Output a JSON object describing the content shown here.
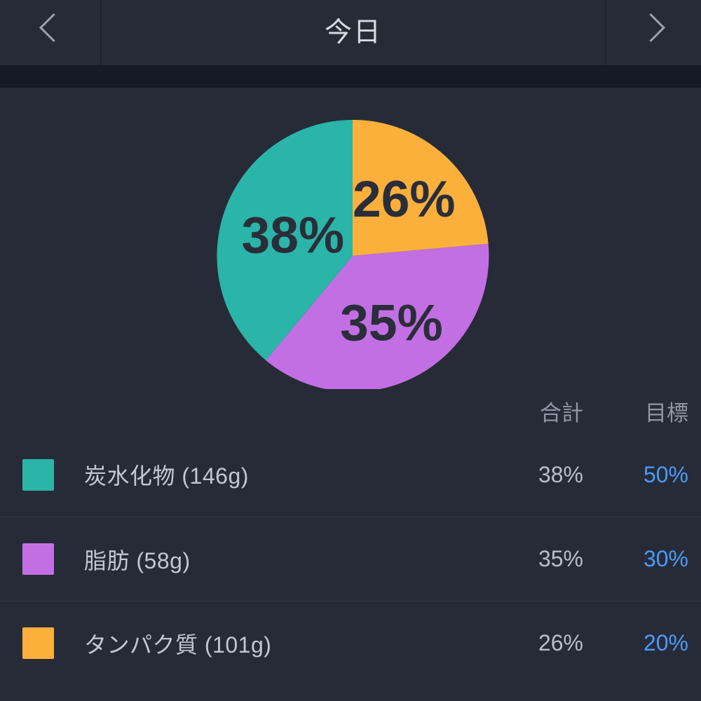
{
  "header": {
    "title": "今日",
    "prev_icon": "chevron-left-icon",
    "next_icon": "chevron-right-icon"
  },
  "colors": {
    "background": "#272b38",
    "band": "#161a27",
    "divider": "#343a49",
    "carbs": "#2bb5a9",
    "fat": "#c26fe3",
    "protein": "#fbb03b",
    "goal_text": "#4a9bf5",
    "slice_label": "#2a2e3a"
  },
  "table": {
    "columns": {
      "name": "",
      "total": "合計",
      "goal": "目標"
    },
    "rows": [
      {
        "color": "#2bb5a9",
        "label": "炭水化物 (146g)",
        "nutrient": "炭水化物",
        "grams": "146g",
        "total": "38%",
        "goal": "50%"
      },
      {
        "color": "#c26fe3",
        "label": "脂肪 (58g)",
        "nutrient": "脂肪",
        "grams": "58g",
        "total": "35%",
        "goal": "30%"
      },
      {
        "color": "#fbb03b",
        "label": "タンパク質 (101g)",
        "nutrient": "タンパク質",
        "grams": "101g",
        "total": "26%",
        "goal": "20%"
      }
    ]
  },
  "chart_data": {
    "type": "pie",
    "title": "",
    "labels": [
      "タンパク質",
      "脂肪",
      "炭水化物"
    ],
    "values": [
      26,
      35,
      38
    ],
    "display_labels": [
      "26%",
      "35%",
      "38%"
    ],
    "colors": [
      "#fbb03b",
      "#c26fe3",
      "#2bb5a9"
    ],
    "start_angle_deg": 0,
    "direction": "clockwise",
    "legend_position": "below",
    "grid": false,
    "units": "percent",
    "goals": [
      20,
      30,
      50
    ],
    "grams": [
      101,
      58,
      146
    ]
  }
}
